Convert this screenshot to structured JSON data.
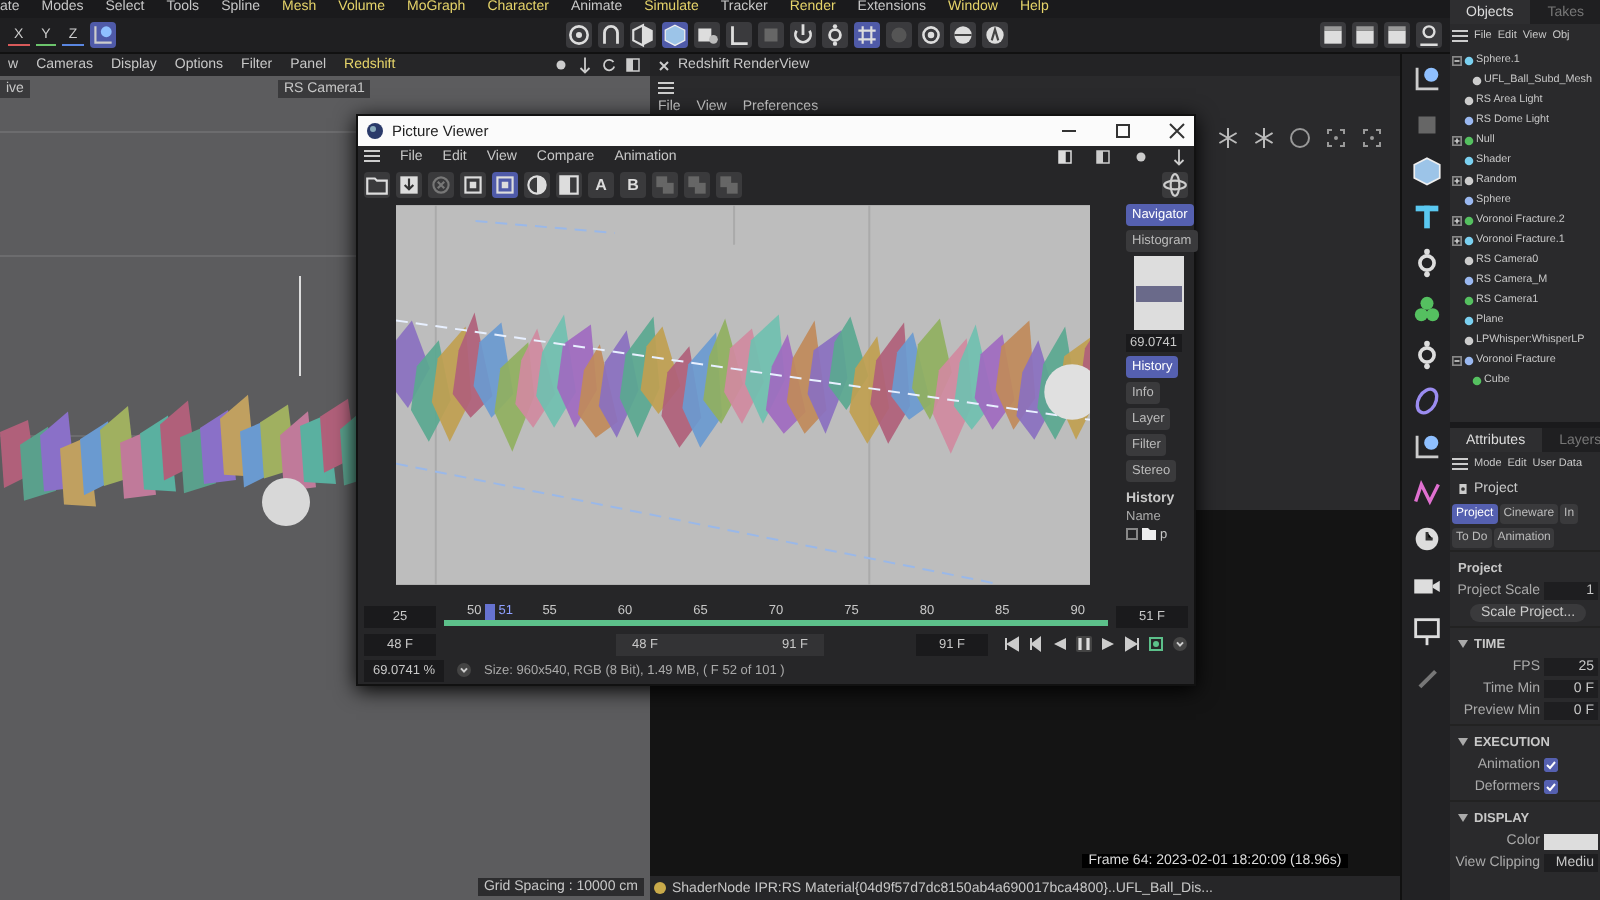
{
  "menu_bar": [
    {
      "label": "ate",
      "accent": false
    },
    {
      "label": "Modes",
      "accent": false
    },
    {
      "label": "Select",
      "accent": false
    },
    {
      "label": "Tools",
      "accent": false
    },
    {
      "label": "Spline",
      "accent": false
    },
    {
      "label": "Mesh",
      "accent": true
    },
    {
      "label": "Volume",
      "accent": true
    },
    {
      "label": "MoGraph",
      "accent": true
    },
    {
      "label": "Character",
      "accent": true
    },
    {
      "label": "Animate",
      "accent": false
    },
    {
      "label": "Simulate",
      "accent": true
    },
    {
      "label": "Tracker",
      "accent": false
    },
    {
      "label": "Render",
      "accent": true
    },
    {
      "label": "Extensions",
      "accent": false
    },
    {
      "label": "Window",
      "accent": true
    },
    {
      "label": "Help",
      "accent": true
    }
  ],
  "axis_buttons": [
    {
      "label": "X",
      "color": "#d85a5a"
    },
    {
      "label": "Y",
      "color": "#6cc46c"
    },
    {
      "label": "Z",
      "color": "#5a86e0"
    }
  ],
  "viewport": {
    "menu": [
      {
        "label": "w",
        "accent": false
      },
      {
        "label": "Cameras",
        "accent": false
      },
      {
        "label": "Display",
        "accent": false
      },
      {
        "label": "Options",
        "accent": false
      },
      {
        "label": "Filter",
        "accent": false
      },
      {
        "label": "Panel",
        "accent": false
      },
      {
        "label": "Redshift",
        "accent": true
      }
    ],
    "view_label": "ive",
    "camera": "RS Camera1",
    "grid_spacing": "Grid Spacing : 10000 cm"
  },
  "renderview": {
    "title": "Redshift RenderView",
    "menu": [
      "File",
      "View",
      "Preferences"
    ],
    "frame_info": "Frame  64:  2023-02-01  18:20:09  (18.96s)",
    "status": "ShaderNode IPR:RS Material{04d9f57d7dc8150ab4a690017bca4800}..UFL_Ball_Dis..."
  },
  "picture_viewer": {
    "title": "Picture Viewer",
    "menu": [
      "File",
      "Edit",
      "View",
      "Compare",
      "Animation"
    ],
    "toolbar_letters": [
      "A",
      "B"
    ],
    "side_tabs": [
      {
        "label": "Navigator",
        "selected": true
      },
      {
        "label": "Histogram",
        "selected": false
      }
    ],
    "zoom_value": "69.0741",
    "info_tabs": [
      {
        "label": "History",
        "selected": true
      },
      {
        "label": "Info",
        "selected": false
      },
      {
        "label": "Layer",
        "selected": false
      },
      {
        "label": "Filter",
        "selected": false
      },
      {
        "label": "Stereo",
        "selected": false
      }
    ],
    "history_heading": "History",
    "history_column": "Name",
    "history_row": {
      "label": "p",
      "checked": false
    },
    "timeline": {
      "start_field": "25",
      "end_field": "51 F",
      "ticks": [
        {
          "label": "50",
          "selected": false
        },
        {
          "label": "51",
          "selected": true
        },
        {
          "label": "55",
          "selected": false
        },
        {
          "label": "60",
          "selected": false
        },
        {
          "label": "65",
          "selected": false
        },
        {
          "label": "70",
          "selected": false
        },
        {
          "label": "75",
          "selected": false
        },
        {
          "label": "80",
          "selected": false
        },
        {
          "label": "85",
          "selected": false
        },
        {
          "label": "90",
          "selected": false
        }
      ],
      "range_start": "48 F",
      "range_from": "48 F",
      "range_to": "91 F",
      "range_end": "91 F"
    },
    "zoom_field": "69.0741 %",
    "info": "Size: 960x540, RGB (8 Bit), 1.49 MB,  ( F 52 of 101 )"
  },
  "objects_panel": {
    "tabs": [
      {
        "label": "Objects",
        "selected": true
      },
      {
        "label": "Takes",
        "selected": false
      }
    ],
    "menu": [
      "File",
      "Edit",
      "View",
      "Obj"
    ],
    "tree": [
      {
        "name": "Sphere.1",
        "expanded": true,
        "children": [
          {
            "name": "UFL_Ball_Subd_Mesh"
          }
        ]
      },
      {
        "name": "RS Area Light"
      },
      {
        "name": "RS Dome Light"
      },
      {
        "name": "Null",
        "expanded": false
      },
      {
        "name": "Shader"
      },
      {
        "name": "Random",
        "expanded": false
      },
      {
        "name": "Sphere"
      },
      {
        "name": "Voronoi Fracture.2",
        "expanded": false
      },
      {
        "name": "Voronoi Fracture.1",
        "expanded": false
      },
      {
        "name": "RS Camera0"
      },
      {
        "name": "RS Camera_M"
      },
      {
        "name": "RS Camera1"
      },
      {
        "name": "Plane"
      },
      {
        "name": "LPWhisper:WhisperLP"
      },
      {
        "name": "Voronoi Fracture",
        "expanded": true,
        "children": [
          {
            "name": "Cube"
          }
        ]
      }
    ]
  },
  "attributes_panel": {
    "tabs": [
      {
        "label": "Attributes",
        "selected": true
      },
      {
        "label": "Layers",
        "selected": false
      }
    ],
    "menu": [
      "Mode",
      "Edit",
      "User Data"
    ],
    "object": "Project",
    "mode_tabs": [
      {
        "label": "Project",
        "selected": true
      },
      {
        "label": "Cineware",
        "selected": false
      },
      {
        "label": "In",
        "selected": false
      }
    ],
    "sub_tabs": [
      "To Do",
      "Animation"
    ],
    "sections": [
      {
        "title": "Project",
        "rows": [
          {
            "kind": "field",
            "label": "Project Scale",
            "value": "1"
          },
          {
            "kind": "button",
            "label": "Scale Project..."
          }
        ]
      },
      {
        "title": "TIME",
        "expanded": true,
        "rows": [
          {
            "kind": "field",
            "label": "FPS",
            "value": "25"
          },
          {
            "kind": "field",
            "label": "Time Min",
            "value": "0 F"
          },
          {
            "kind": "field",
            "label": "Preview Min",
            "value": "0 F"
          }
        ]
      },
      {
        "title": "EXECUTION",
        "expanded": true,
        "rows": [
          {
            "kind": "checkbox",
            "label": "Animation",
            "checked": true
          },
          {
            "kind": "checkbox",
            "label": "Deformers",
            "checked": true
          }
        ]
      },
      {
        "title": "DISPLAY",
        "expanded": true,
        "rows": [
          {
            "kind": "color",
            "label": "Color"
          },
          {
            "kind": "dropdown",
            "label": "View Clipping",
            "value": "Mediu"
          }
        ]
      }
    ]
  }
}
